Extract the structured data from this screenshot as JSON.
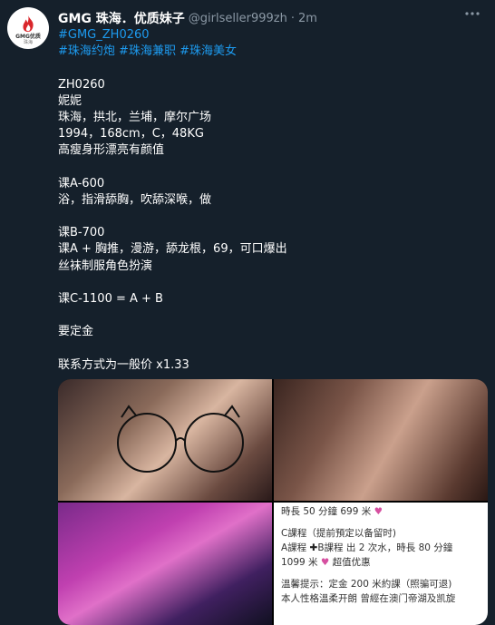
{
  "author": {
    "display_name": "GMG 珠海．优质妹子",
    "handle": "@girlseller999zh",
    "separator": "·",
    "time": "2m",
    "avatar_brand": "GMG优质",
    "avatar_sub": "珠海"
  },
  "more_icon": "more-dots-icon",
  "tweet": {
    "hashtag_code": "#GMG_ZH0260",
    "hashtags": [
      "#珠海约炮",
      "#珠海兼职",
      "#珠海美女"
    ],
    "lines": [
      "ZH0260",
      "妮妮",
      "珠海，拱北，兰埔，摩尔广场",
      "1994，168cm，C，48KG",
      "高瘦身形漂亮有颜值",
      "",
      "课A-600",
      "浴，指滑舔胸，吹舔深喉，做",
      "",
      "课B-700",
      "课A + 胸推，漫游，舔龙根，69，可口爆出",
      "丝袜制服角色扮演",
      "",
      "课C-1100 = A + B",
      "",
      "要定金",
      "",
      "联系方式为一般价 x1.33"
    ]
  },
  "photo_text": {
    "line1": "時長 50 分鐘 699 米",
    "line2": "C課程（提前預定以备留时)",
    "line3a": "A課程",
    "line3b": "B課程 出 2 次水，時長 80 分鐘",
    "line4a": "1099 米",
    "line4b": "超值优惠",
    "line5": "溫馨提示：定金 200 米約課（照骗可退)",
    "line6": "本人性格溫柔开朗 曾經在澳门帝湖及凯旋"
  },
  "colors": {
    "background": "#15202b",
    "hashtag": "#1d9bf0",
    "muted": "#8b98a5"
  }
}
